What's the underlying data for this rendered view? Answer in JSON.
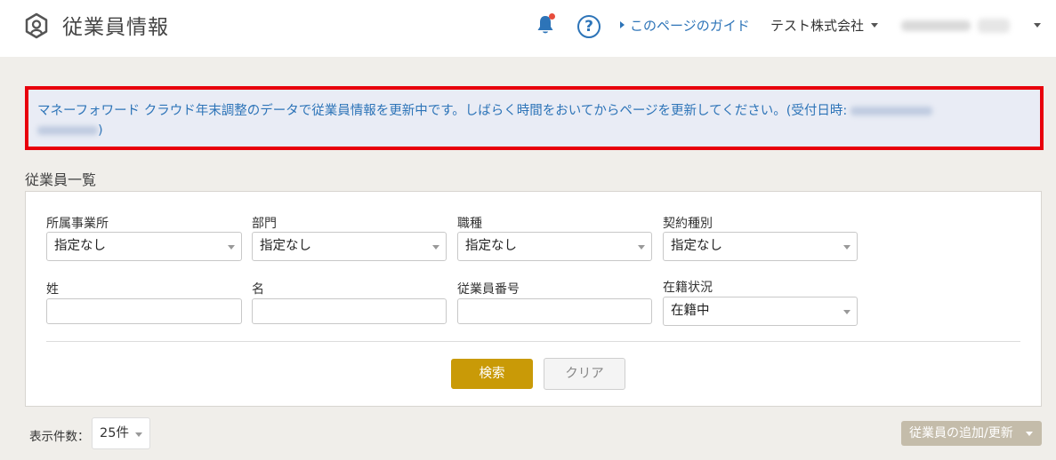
{
  "header": {
    "title": "従業員情報",
    "help_symbol": "?",
    "guide_link": "このページのガイド",
    "company": "テスト株式会社"
  },
  "notice": {
    "message": "マネーフォワード クラウド年末調整のデータで従業員情報を更新中です。しばらく時間をおいてからページを更新してください。(受付日時:",
    "close_paren": ")"
  },
  "list": {
    "title": "従業員一覧"
  },
  "filters": {
    "office": {
      "label": "所属事業所",
      "value": "指定なし"
    },
    "department": {
      "label": "部門",
      "value": "指定なし"
    },
    "job_type": {
      "label": "職種",
      "value": "指定なし"
    },
    "contract_type": {
      "label": "契約種別",
      "value": "指定なし"
    },
    "last_name": {
      "label": "姓",
      "value": ""
    },
    "first_name": {
      "label": "名",
      "value": ""
    },
    "employee_number": {
      "label": "従業員番号",
      "value": ""
    },
    "status": {
      "label": "在籍状況",
      "value": "在籍中"
    }
  },
  "buttons": {
    "search": "検索",
    "clear": "クリア",
    "add_update": "従業員の追加/更新"
  },
  "pagination": {
    "per_page_label": "表示件数：",
    "per_page_value": "25件"
  },
  "colors": {
    "accent": "#c99a07",
    "link": "#2d74b8",
    "highlight_border": "#e8000b",
    "notice_bg": "#e9ecf5"
  }
}
